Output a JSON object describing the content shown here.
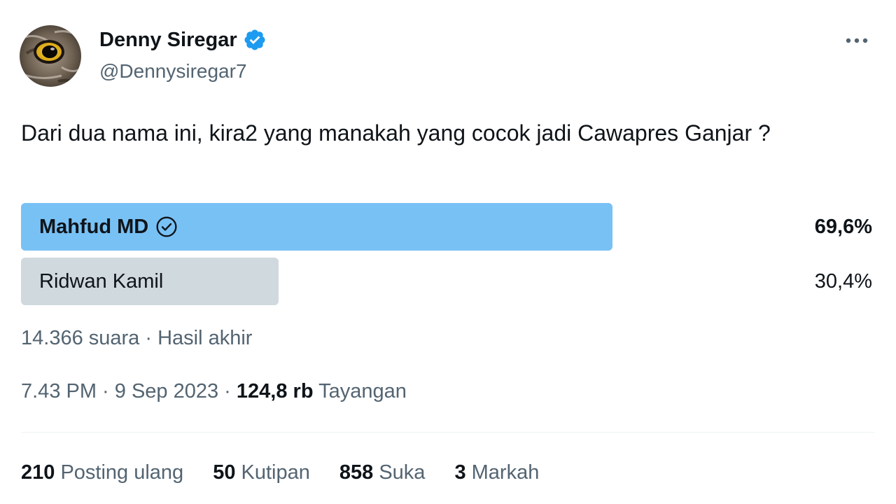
{
  "colors": {
    "accent": "#1d9bf0",
    "winner_fill": "#78c1f5",
    "loser_fill": "#cfd9de",
    "secondary_text": "#536471",
    "primary_text": "#0f1419"
  },
  "author": {
    "display_name": "Denny Siregar",
    "handle": "@Dennysiregar7",
    "avatar_icon": "owl-eye-avatar",
    "verified_icon": "verified-badge-icon"
  },
  "more_icon": "more-horizontal-icon",
  "tweet": {
    "text": "Dari dua nama ini, kira2 yang manakah yang cocok jadi Cawapres Ganjar ?"
  },
  "poll": {
    "options": [
      {
        "label": "Mahfud MD",
        "percent_text": "69,6%",
        "percent": 69.6,
        "winner": true
      },
      {
        "label": "Ridwan Kamil",
        "percent_text": "30,4%",
        "percent": 30.4,
        "winner": false
      }
    ],
    "meta": "14.366 suara · Hasil akhir"
  },
  "timestamp": {
    "time_date": "7.43 PM · 9 Sep 2023 · ",
    "views_count": "124,8 rb",
    "views_label": " Tayangan"
  },
  "stats": {
    "reposts": {
      "num": "210",
      "label": " Posting ulang"
    },
    "quotes": {
      "num": "50",
      "label": " Kutipan"
    },
    "likes": {
      "num": "858",
      "label": " Suka"
    },
    "bookmarks": {
      "num": "3",
      "label": " Markah"
    }
  }
}
